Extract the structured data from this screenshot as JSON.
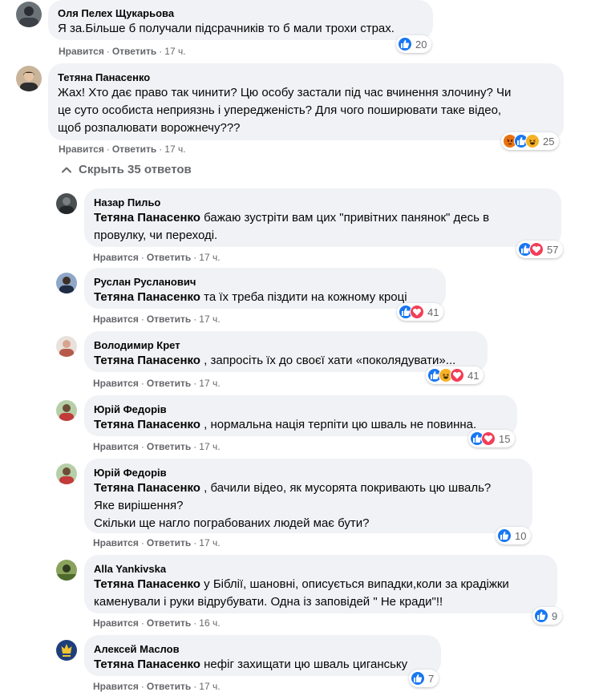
{
  "comments": [
    {
      "name": "Оля Пелех Щукарьова",
      "lines": [
        [
          "",
          "Я за.Більше б получали підсрачників то б мали трохи страх."
        ]
      ],
      "like": "Нравится",
      "reply": "Ответить",
      "time": "17 ч.",
      "reaction_count": "20",
      "reactions": [
        "like"
      ]
    },
    {
      "name": "Тетяна Панасенко",
      "lines": [
        [
          "",
          "Жах! Хто дає право так чинити? Цю особу застали під час вчинення злочину? Чи"
        ],
        [
          "",
          "це суто особиста неприязнь і упередженість? Для чого поширювати таке відео,"
        ],
        [
          "",
          "щоб розпалювати ворожнечу???"
        ]
      ],
      "like": "Нравится",
      "reply": "Ответить",
      "time": "17 ч.",
      "reaction_count": "25",
      "reactions": [
        "angry",
        "like",
        "haha"
      ]
    }
  ],
  "hide_replies": "Скрыть 35 ответов",
  "replies": [
    {
      "name": "Назар Пильо",
      "lines": [
        [
          "Тетяна Панасенко",
          " бажаю зустріти вам цих \"привітних панянок\" десь в"
        ],
        [
          "",
          "провулку, чи переході."
        ]
      ],
      "like": "Нравится",
      "reply": "Ответить",
      "time": "17 ч.",
      "reaction_count": "57",
      "reactions": [
        "like",
        "love"
      ]
    },
    {
      "name": "Руслан Русланович",
      "lines": [
        [
          "Тетяна Панасенко",
          " та їх треба піздити на кожному кроці"
        ]
      ],
      "like": "Нравится",
      "reply": "Ответить",
      "time": "17 ч.",
      "reaction_count": "41",
      "reactions": [
        "like",
        "love"
      ]
    },
    {
      "name": "Володимир Крет",
      "lines": [
        [
          "Тетяна Панасенко",
          " , запросіть їх до своєї хати «поколядувати»..."
        ]
      ],
      "like": "Нравится",
      "reply": "Ответить",
      "time": "17 ч.",
      "reaction_count": "41",
      "reactions": [
        "like",
        "haha",
        "love"
      ]
    },
    {
      "name": "Юрій Федорів",
      "lines": [
        [
          "Тетяна Панасенко",
          " , нормальна нація терпіти цю шваль не повинна."
        ]
      ],
      "like": "Нравится",
      "reply": "Ответить",
      "time": "17 ч.",
      "reaction_count": "15",
      "reactions": [
        "like",
        "love"
      ]
    },
    {
      "name": "Юрій Федорів",
      "lines": [
        [
          "Тетяна Панасенко",
          " , бачили відео, як мусорята покривають цю шваль?"
        ],
        [
          "",
          "Яке вирішення?"
        ],
        [
          "",
          "Скільки ще нагло пограбованих людей має бути?"
        ]
      ],
      "like": "Нравится",
      "reply": "Ответить",
      "time": "17 ч.",
      "reaction_count": "10",
      "reactions": [
        "like"
      ]
    },
    {
      "name": "Alla Yankivska",
      "lines": [
        [
          "Тетяна Панасенко",
          " у Біблії, шановні, описується випадки,коли за крадіжки"
        ],
        [
          "",
          "каменували і руки відрубувати. Одна із заповідей \" Не кради\"!!"
        ]
      ],
      "like": "Нравится",
      "reply": "Ответить",
      "time": "16 ч.",
      "reaction_count": "9",
      "reactions": [
        "like"
      ]
    },
    {
      "name": "Алексей Маслов",
      "lines": [
        [
          "Тетяна Панасенко",
          " нефіг захищати цю шваль циганську"
        ]
      ],
      "like": "Нравится",
      "reply": "Ответить",
      "time": "17 ч.",
      "reaction_count": "7",
      "reactions": [
        "like"
      ]
    }
  ],
  "colors": {
    "bubble": "#f0f2f5",
    "meta": "#65676b",
    "like": "#1877f2",
    "love": "#f33e58",
    "haha": "#f7b125",
    "angry": "#e9710f"
  }
}
